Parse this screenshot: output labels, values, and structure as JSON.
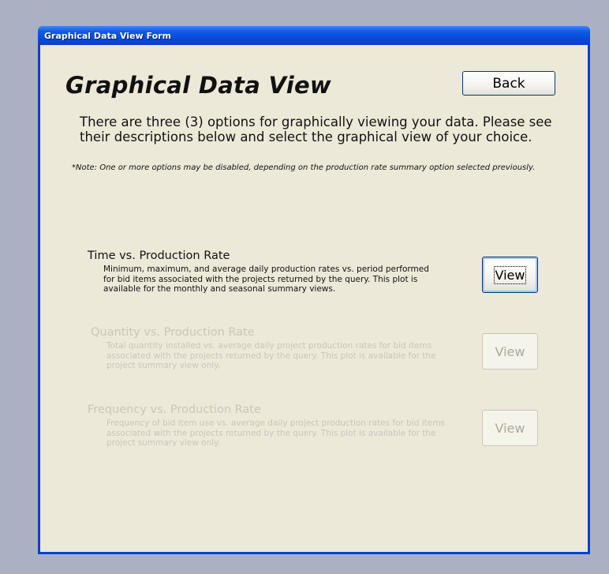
{
  "window": {
    "title": "Graphical Data View Form"
  },
  "header": {
    "title": "Graphical Data View",
    "back_label": "Back"
  },
  "intro": {
    "text": "There are three (3) options for graphically viewing your data.  Please see their descriptions below and select the graphical view of your choice.",
    "note": "*Note:  One or more options may be disabled, depending on the production rate summary option selected previously."
  },
  "options": [
    {
      "title": "Time vs. Production Rate",
      "description": "Minimum, maximum, and average daily production rates vs. period performed for bid items associated with the projects returned by the query.  This plot is available for the monthly and seasonal summary views.",
      "button_label": "View",
      "enabled": true
    },
    {
      "title": "Quantity vs. Production Rate",
      "description": "Total quantity installed vs. average daily project production rates for bid items associated with the projects returned by the query.  This plot is available for the project summary view only.",
      "button_label": "View",
      "enabled": false
    },
    {
      "title": "Frequency vs. Production Rate",
      "description": "Frequency of bid item use vs. average daily project production rates for bid items associated with the projects returned by the query.  This plot is available for the project summary view only.",
      "button_label": "View",
      "enabled": false
    }
  ],
  "colors": {
    "title_bar": "#0a48d6",
    "client_background": "#ece9d8",
    "disabled_text": "#c9c6bd",
    "desktop": "#aab1c2"
  }
}
